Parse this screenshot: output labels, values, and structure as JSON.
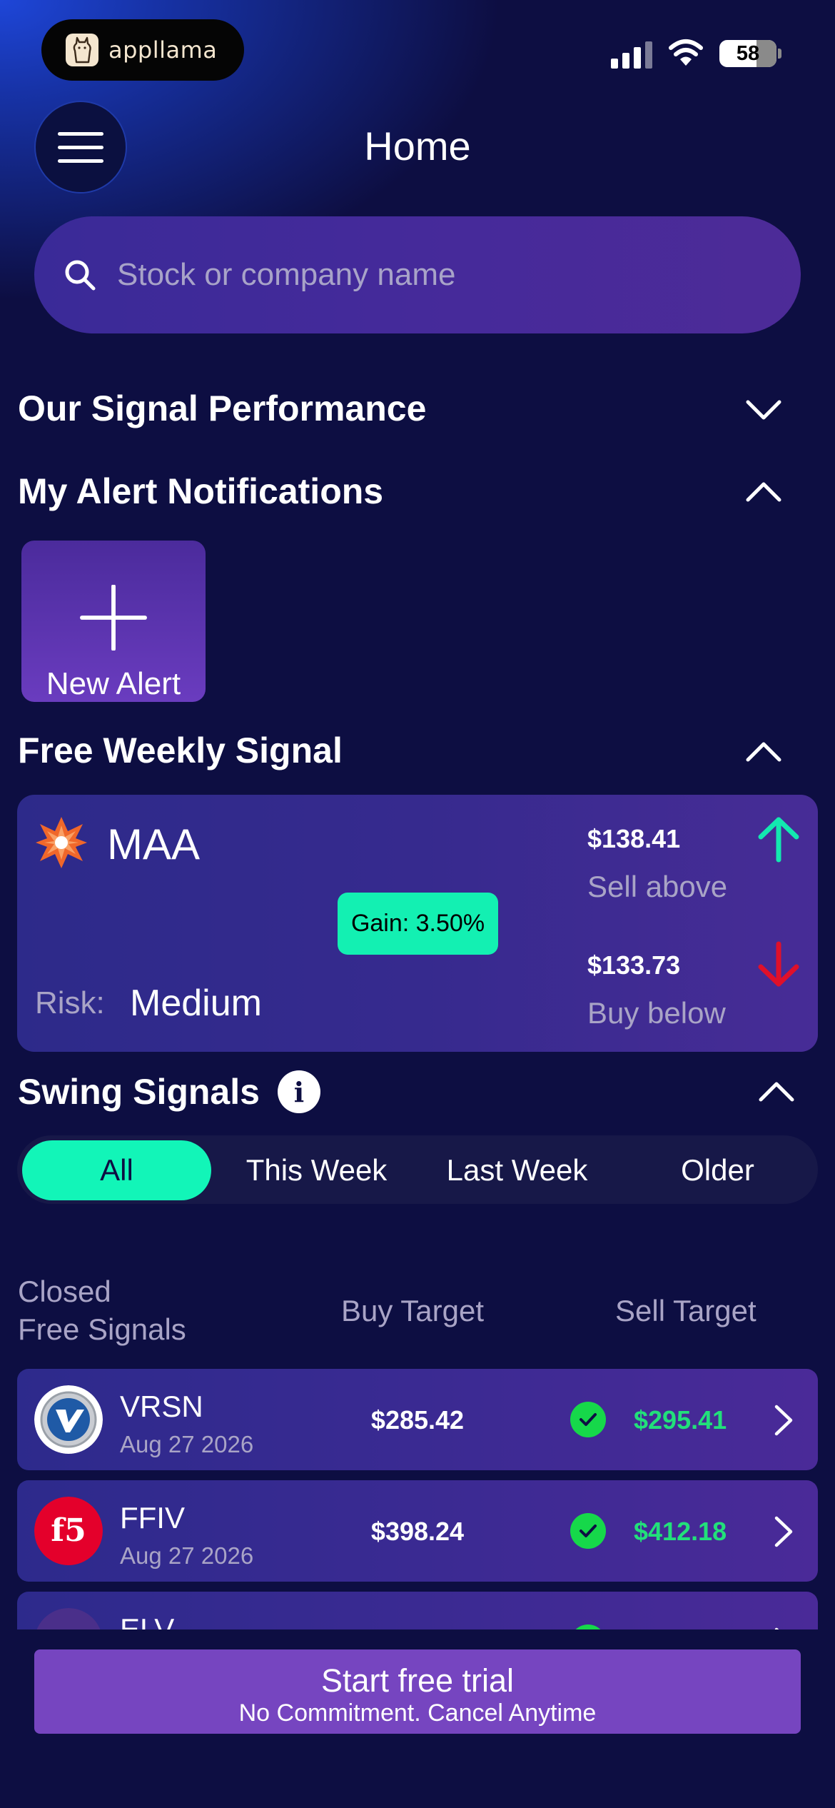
{
  "status_bar": {
    "brand": "appllama",
    "battery": "58"
  },
  "header": {
    "title": "Home"
  },
  "search": {
    "placeholder": "Stock or company name"
  },
  "sections": {
    "performance": "Our Signal Performance",
    "alerts": "My Alert Notifications",
    "weekly": "Free Weekly Signal",
    "swing": "Swing Signals"
  },
  "new_alert": {
    "label": "New Alert"
  },
  "weekly_signal": {
    "ticker": "MAA",
    "gain": "Gain: 3.50%",
    "risk_label": "Risk:",
    "risk_value": "Medium",
    "sell_price": "$138.41",
    "sell_label": "Sell above",
    "buy_price": "$133.73",
    "buy_label": "Buy below"
  },
  "tabs": [
    {
      "label": "All"
    },
    {
      "label": "This Week"
    },
    {
      "label": "Last Week"
    },
    {
      "label": "Older"
    }
  ],
  "table": {
    "headers": {
      "col1_line1": "Closed",
      "col1_line2": "Free Signals",
      "buy": "Buy Target",
      "sell": "Sell Target"
    },
    "rows": [
      {
        "ticker": "VRSN",
        "date": "Aug 27 2026",
        "buy": "$285.42",
        "sell": "$295.41"
      },
      {
        "ticker": "FFIV",
        "date": "Aug 27 2026",
        "buy": "$398.24",
        "sell": "$412.18"
      },
      {
        "ticker": "ELV",
        "date": "",
        "buy": "",
        "sell": ""
      }
    ]
  },
  "cta": {
    "title": "Start free trial",
    "subtitle": "No Commitment. Cancel Anytime"
  },
  "colors": {
    "accent": "#12f5b8",
    "up": "#13e8b0",
    "down": "#e0102a",
    "sell_green": "#22e07a",
    "cta": "#7645c0"
  }
}
